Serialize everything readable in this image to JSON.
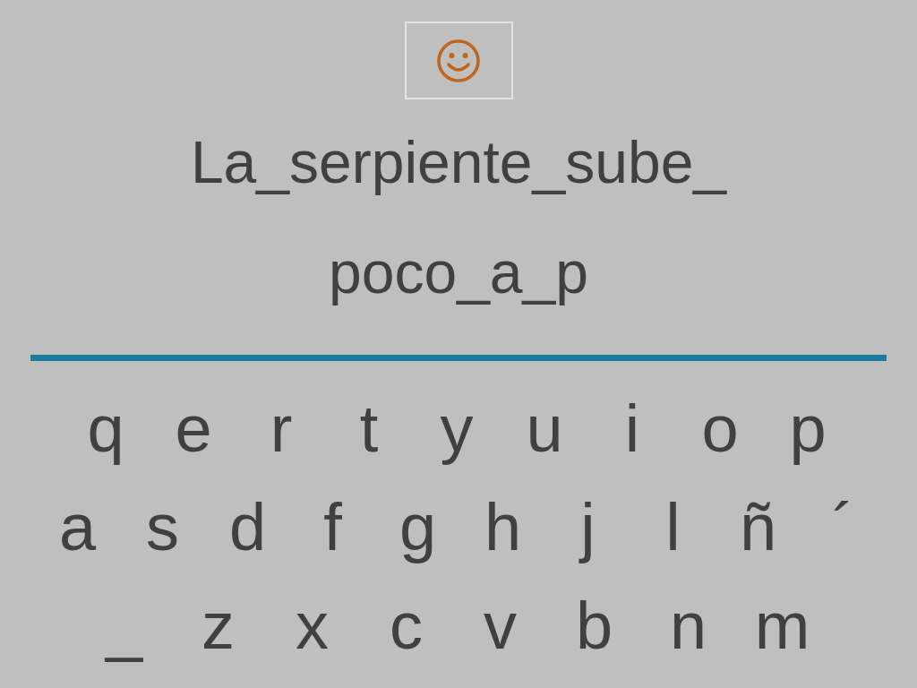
{
  "answer_lines": [
    "La_serpiente_sube_",
    "poco_a_p"
  ],
  "keyboard": {
    "rows": [
      [
        "q",
        "e",
        "r",
        "t",
        "y",
        "u",
        "i",
        "o",
        "p"
      ],
      [
        "a",
        "s",
        "d",
        "f",
        "g",
        "h",
        "j",
        "l",
        "ñ",
        "´"
      ],
      [
        "_",
        "z",
        "x",
        "c",
        "v",
        "b",
        "n",
        "m"
      ]
    ]
  }
}
